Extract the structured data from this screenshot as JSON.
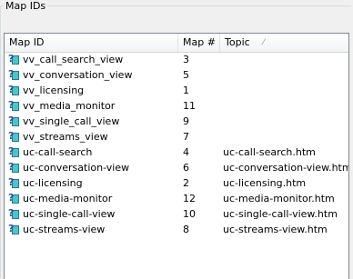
{
  "group": {
    "title": "Map IDs"
  },
  "columns": {
    "map_id": "Map ID",
    "map_num": "Map #",
    "topic": "Topic"
  },
  "rows": [
    {
      "id": "vv_call_search_view",
      "num": "3",
      "topic": ""
    },
    {
      "id": "vv_conversation_view",
      "num": "5",
      "topic": ""
    },
    {
      "id": "vv_licensing",
      "num": "1",
      "topic": ""
    },
    {
      "id": "vv_media_monitor",
      "num": "11",
      "topic": ""
    },
    {
      "id": "vv_single_call_view",
      "num": "9",
      "topic": ""
    },
    {
      "id": "vv_streams_view",
      "num": "7",
      "topic": ""
    },
    {
      "id": "uc-call-search",
      "num": "4",
      "topic": "uc-call-search.htm"
    },
    {
      "id": "uc-conversation-view",
      "num": "6",
      "topic": "uc-conversation-view.htm"
    },
    {
      "id": "uc-licensing",
      "num": "2",
      "topic": "uc-licensing.htm"
    },
    {
      "id": "uc-media-monitor",
      "num": "12",
      "topic": "uc-media-monitor.htm"
    },
    {
      "id": "uc-single-call-view",
      "num": "10",
      "topic": "uc-single-call-view.htm"
    },
    {
      "id": "uc-streams-view",
      "num": "8",
      "topic": "uc-streams-view.htm"
    }
  ],
  "icons": {
    "row_icon": "help-topic-icon",
    "sort_indicator": "sort-arrow-icon"
  }
}
